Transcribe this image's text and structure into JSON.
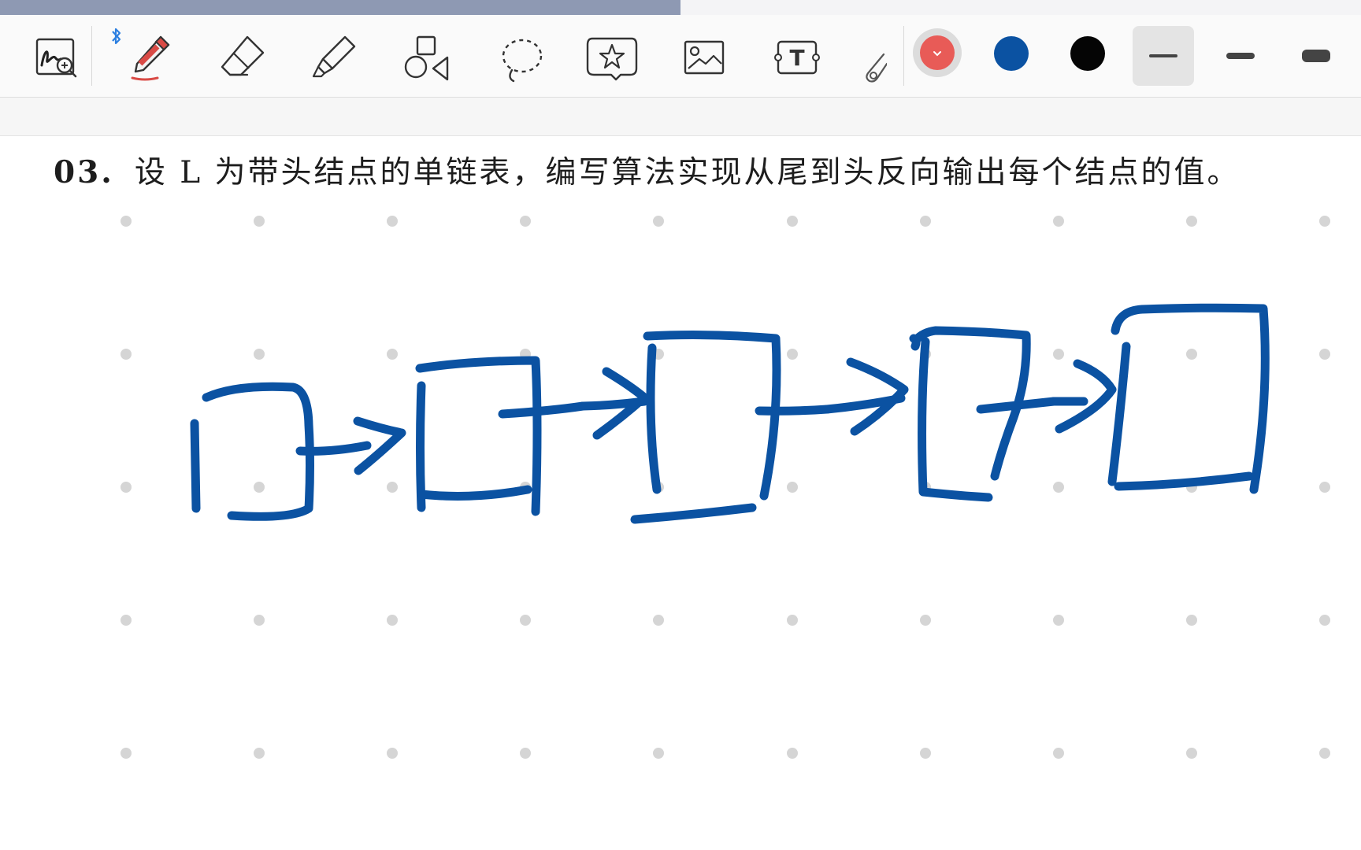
{
  "toolbar": {
    "tools": [
      {
        "name": "zoom-writing",
        "icon": "handwriting-zoom-icon"
      },
      {
        "name": "pen",
        "icon": "pen-icon",
        "active": true
      },
      {
        "name": "eraser",
        "icon": "eraser-icon"
      },
      {
        "name": "highlighter",
        "icon": "highlighter-icon"
      },
      {
        "name": "shapes",
        "icon": "shapes-icon"
      },
      {
        "name": "lasso",
        "icon": "lasso-icon"
      },
      {
        "name": "sticker",
        "icon": "sticker-star-icon"
      },
      {
        "name": "image",
        "icon": "image-icon"
      },
      {
        "name": "text",
        "icon": "text-box-icon"
      },
      {
        "name": "laser",
        "icon": "laser-pointer-icon"
      }
    ],
    "text_tool_glyph": "T",
    "bluetooth_connected": true,
    "colors": [
      {
        "name": "red",
        "hex": "#e85b57",
        "selected": true
      },
      {
        "name": "blue",
        "hex": "#0b52a2",
        "selected": false
      },
      {
        "name": "black",
        "hex": "#050505",
        "selected": false
      }
    ],
    "stroke_widths": [
      {
        "name": "thin",
        "selected": true
      },
      {
        "name": "medium",
        "selected": false
      },
      {
        "name": "thick",
        "selected": false
      }
    ]
  },
  "document": {
    "question_number": "03.",
    "question_text": "设 L 为带头结点的单链表，编写算法实现从尾到头反向输出每个结点的值。"
  },
  "drawing": {
    "ink_color": "#0b52a2",
    "dot_grid_color": "#d5d5d5",
    "node_count": 5
  }
}
